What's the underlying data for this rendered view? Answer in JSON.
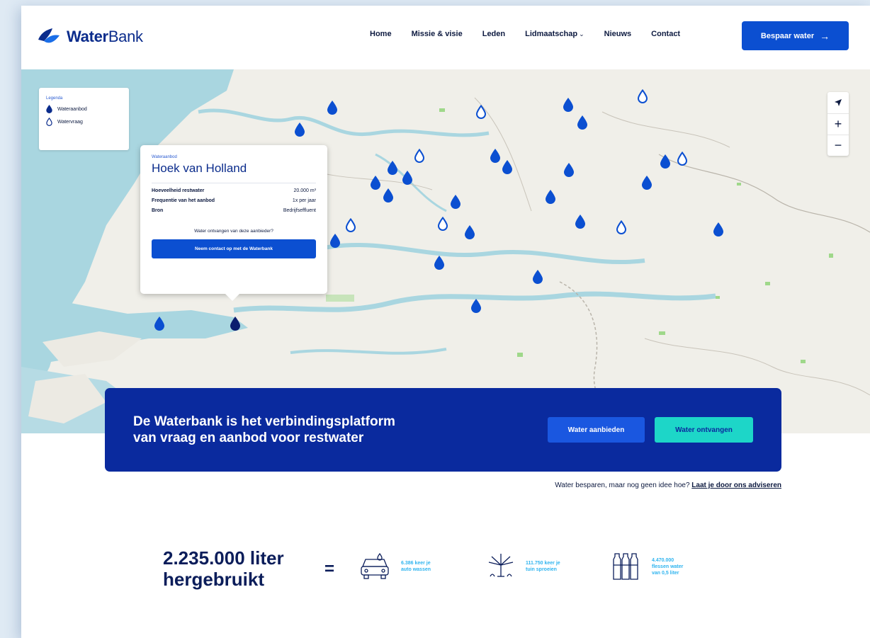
{
  "header": {
    "logo": {
      "bold": "Water",
      "light": "Bank"
    },
    "nav": [
      {
        "label": "Home"
      },
      {
        "label": "Missie & visie"
      },
      {
        "label": "Leden"
      },
      {
        "label": "Lidmaatschap"
      },
      {
        "label": "Nieuws"
      },
      {
        "label": "Contact"
      }
    ],
    "cta_label": "Bespaar water"
  },
  "legend": {
    "title": "Legenda",
    "items": [
      {
        "label": "Wateraanbod",
        "icon": "filled-drop-icon"
      },
      {
        "label": "Watervraag",
        "icon": "outline-drop-icon"
      }
    ]
  },
  "popup": {
    "kicker": "Wateraanbod",
    "title": "Hoek van Holland",
    "rows": [
      {
        "key": "Hoeveelheid restwater",
        "value": "20.000 m³"
      },
      {
        "key": "Frequentie van het aanbod",
        "value": "1x per jaar"
      },
      {
        "key": "Bron",
        "value": "Bedrijfseffluent"
      }
    ],
    "question": "Water ontvangen van deze aanbieder?",
    "button": "Neem contact op met de Waterbank"
  },
  "banner": {
    "line1": "De Waterbank is het verbindingsplatform",
    "line2": "van vraag en aanbod voor restwater",
    "btn_offer": "Water aanbieden",
    "btn_receive": "Water ontvangen"
  },
  "advice": {
    "text": "Water besparen, maar nog geen idee hoe?",
    "link": "Laat je door ons adviseren"
  },
  "stats": {
    "big_line1": "2.235.000 liter",
    "big_line2": "hergebruikt",
    "equals": "=",
    "items": [
      {
        "icon": "car-wash-icon",
        "line1": "6.386 keer je",
        "line2": "auto wassen"
      },
      {
        "icon": "sprinkler-icon",
        "line1": "111.750 keer je",
        "line2": "tuin sproeien"
      },
      {
        "icon": "bottles-icon",
        "line1": "4.470.000",
        "line2": "flessen water",
        "line3": "van 0,5 liter"
      }
    ]
  },
  "colors": {
    "brand_blue": "#0b4fd1",
    "navy": "#0a2a9e",
    "teal": "#1dd6c8",
    "drop_blue": "#0b4fd1",
    "sea": "#a9d6e0"
  }
}
